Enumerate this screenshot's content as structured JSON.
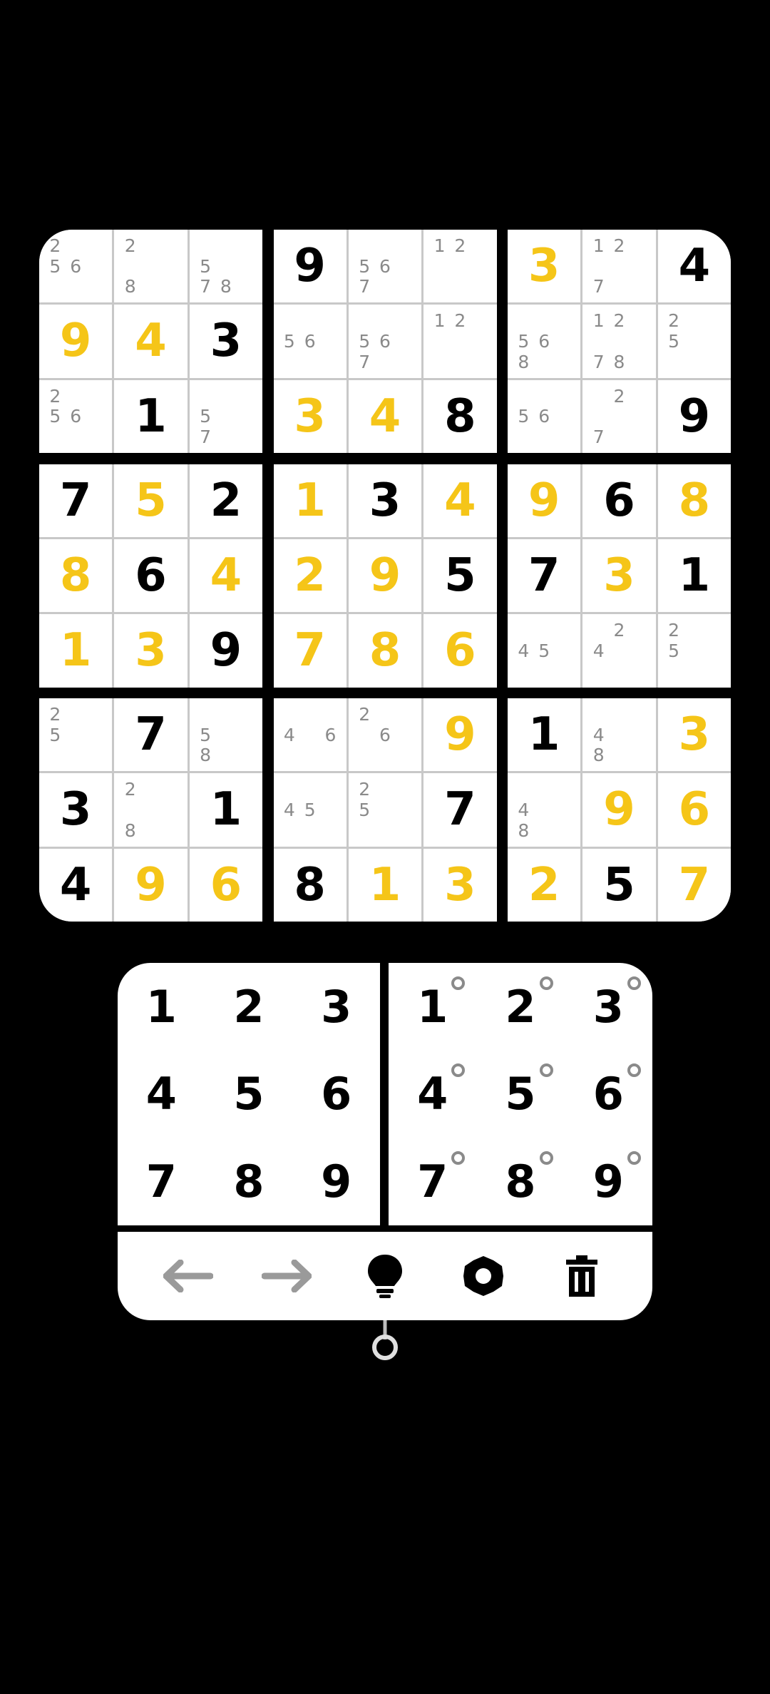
{
  "board": {
    "boxes": [
      [
        {
          "v": "",
          "t": "n",
          "notes": [
            "2",
            "",
            "",
            "5",
            "6",
            "",
            "",
            "",
            ""
          ]
        },
        {
          "v": "",
          "t": "n",
          "notes": [
            "2",
            "",
            "",
            "",
            "",
            "",
            "8",
            "",
            ""
          ]
        },
        {
          "v": "",
          "t": "n",
          "notes": [
            "",
            "",
            "",
            "5",
            "",
            "",
            "7",
            "8",
            ""
          ]
        },
        {
          "v": "9",
          "t": "e"
        },
        {
          "v": "4",
          "t": "e"
        },
        {
          "v": "3",
          "t": "g"
        },
        {
          "v": "",
          "t": "n",
          "notes": [
            "2",
            "",
            "",
            "5",
            "6",
            "",
            "",
            "",
            ""
          ]
        },
        {
          "v": "1",
          "t": "g"
        },
        {
          "v": "",
          "t": "n",
          "notes": [
            "",
            "",
            "",
            "5",
            "",
            "",
            "7",
            "",
            ""
          ]
        }
      ],
      [
        {
          "v": "9",
          "t": "g"
        },
        {
          "v": "",
          "t": "n",
          "notes": [
            "",
            "",
            "",
            "5",
            "6",
            "",
            "7",
            "",
            ""
          ]
        },
        {
          "v": "",
          "t": "n",
          "notes": [
            "1",
            "2",
            "",
            "",
            "",
            "",
            "",
            "",
            ""
          ]
        },
        {
          "v": "",
          "t": "n",
          "notes": [
            "",
            "",
            "",
            "5",
            "6",
            "",
            "",
            "",
            ""
          ]
        },
        {
          "v": "",
          "t": "n",
          "notes": [
            "",
            "",
            "",
            "5",
            "6",
            "",
            "7",
            "",
            ""
          ]
        },
        {
          "v": "",
          "t": "n",
          "notes": [
            "1",
            "2",
            "",
            "",
            "",
            "",
            "",
            "",
            ""
          ]
        },
        {
          "v": "3",
          "t": "e"
        },
        {
          "v": "4",
          "t": "e"
        },
        {
          "v": "8",
          "t": "g"
        }
      ],
      [
        {
          "v": "3",
          "t": "e"
        },
        {
          "v": "",
          "t": "n",
          "notes": [
            "1",
            "2",
            "",
            "",
            "",
            "",
            "7",
            "",
            ""
          ]
        },
        {
          "v": "4",
          "t": "g"
        },
        {
          "v": "",
          "t": "n",
          "notes": [
            "",
            "",
            "",
            "5",
            "6",
            "",
            "8",
            "",
            ""
          ]
        },
        {
          "v": "",
          "t": "n",
          "notes": [
            "1",
            "2",
            "",
            "",
            "",
            "",
            "7",
            "8",
            ""
          ]
        },
        {
          "v": "",
          "t": "n",
          "notes": [
            "2",
            "",
            "",
            "5",
            "",
            "",
            "",
            "",
            ""
          ]
        },
        {
          "v": "",
          "t": "n",
          "notes": [
            "",
            "",
            "",
            "5",
            "6",
            "",
            "",
            "",
            ""
          ]
        },
        {
          "v": "",
          "t": "n",
          "notes": [
            "",
            "2",
            "",
            "",
            "",
            "",
            "7",
            "",
            ""
          ]
        },
        {
          "v": "9",
          "t": "g"
        }
      ],
      [
        {
          "v": "7",
          "t": "g"
        },
        {
          "v": "5",
          "t": "e"
        },
        {
          "v": "2",
          "t": "g"
        },
        {
          "v": "8",
          "t": "e"
        },
        {
          "v": "6",
          "t": "g"
        },
        {
          "v": "4",
          "t": "e"
        },
        {
          "v": "1",
          "t": "e"
        },
        {
          "v": "3",
          "t": "e"
        },
        {
          "v": "9",
          "t": "g"
        }
      ],
      [
        {
          "v": "1",
          "t": "e"
        },
        {
          "v": "3",
          "t": "g"
        },
        {
          "v": "4",
          "t": "e"
        },
        {
          "v": "2",
          "t": "e"
        },
        {
          "v": "9",
          "t": "e"
        },
        {
          "v": "5",
          "t": "g"
        },
        {
          "v": "7",
          "t": "e"
        },
        {
          "v": "8",
          "t": "e"
        },
        {
          "v": "6",
          "t": "e"
        }
      ],
      [
        {
          "v": "9",
          "t": "e"
        },
        {
          "v": "6",
          "t": "g"
        },
        {
          "v": "8",
          "t": "e"
        },
        {
          "v": "7",
          "t": "g"
        },
        {
          "v": "3",
          "t": "e"
        },
        {
          "v": "1",
          "t": "g"
        },
        {
          "v": "",
          "t": "n",
          "notes": [
            "",
            "",
            "",
            "4",
            "5",
            "",
            "",
            "",
            ""
          ]
        },
        {
          "v": "",
          "t": "n",
          "notes": [
            "",
            "2",
            "",
            "4",
            "",
            "",
            "",
            "",
            ""
          ]
        },
        {
          "v": "",
          "t": "n",
          "notes": [
            "2",
            "",
            "",
            "5",
            "",
            "",
            "",
            "",
            ""
          ]
        }
      ],
      [
        {
          "v": "",
          "t": "n",
          "notes": [
            "2",
            "",
            "",
            "5",
            "",
            "",
            "",
            "",
            ""
          ]
        },
        {
          "v": "7",
          "t": "g"
        },
        {
          "v": "",
          "t": "n",
          "notes": [
            "",
            "",
            "",
            "5",
            "",
            "",
            "8",
            "",
            ""
          ]
        },
        {
          "v": "3",
          "t": "g"
        },
        {
          "v": "",
          "t": "n",
          "notes": [
            "2",
            "",
            "",
            "",
            "",
            "",
            "8",
            "",
            ""
          ]
        },
        {
          "v": "1",
          "t": "g"
        },
        {
          "v": "4",
          "t": "g"
        },
        {
          "v": "9",
          "t": "e"
        },
        {
          "v": "6",
          "t": "e"
        }
      ],
      [
        {
          "v": "",
          "t": "n",
          "notes": [
            "",
            "",
            "",
            "4",
            "",
            "6",
            "",
            "",
            ""
          ]
        },
        {
          "v": "",
          "t": "n",
          "notes": [
            "2",
            "",
            "",
            "",
            "6",
            "",
            "",
            "",
            ""
          ]
        },
        {
          "v": "9",
          "t": "e"
        },
        {
          "v": "",
          "t": "n",
          "notes": [
            "",
            "",
            "",
            "4",
            "5",
            "",
            "",
            "",
            ""
          ]
        },
        {
          "v": "",
          "t": "n",
          "notes": [
            "2",
            "",
            "",
            "5",
            "",
            "",
            "",
            "",
            ""
          ]
        },
        {
          "v": "7",
          "t": "g"
        },
        {
          "v": "8",
          "t": "g"
        },
        {
          "v": "1",
          "t": "e"
        },
        {
          "v": "3",
          "t": "e"
        }
      ],
      [
        {
          "v": "1",
          "t": "g"
        },
        {
          "v": "",
          "t": "n",
          "notes": [
            "",
            "",
            "",
            "4",
            "",
            "",
            "8",
            "",
            ""
          ]
        },
        {
          "v": "3",
          "t": "e"
        },
        {
          "v": "",
          "t": "n",
          "notes": [
            "",
            "",
            "",
            "4",
            "",
            "",
            "8",
            "",
            ""
          ]
        },
        {
          "v": "9",
          "t": "e"
        },
        {
          "v": "6",
          "t": "e"
        },
        {
          "v": "2",
          "t": "e"
        },
        {
          "v": "5",
          "t": "g"
        },
        {
          "v": "7",
          "t": "e"
        }
      ]
    ]
  },
  "pad_normal": [
    "1",
    "2",
    "3",
    "4",
    "5",
    "6",
    "7",
    "8",
    "9"
  ],
  "pad_notes": [
    "1",
    "2",
    "3",
    "4",
    "5",
    "6",
    "7",
    "8",
    "9"
  ],
  "toolbar": {
    "icons": [
      "arrow-left-icon",
      "arrow-right-icon",
      "lightbulb-icon",
      "gear-icon",
      "trash-icon"
    ]
  },
  "colors": {
    "entered": "#f5c518",
    "given": "#000000",
    "note": "#8a8a8a",
    "disabled_icon": "#9a9a9a",
    "background": "#000000"
  }
}
